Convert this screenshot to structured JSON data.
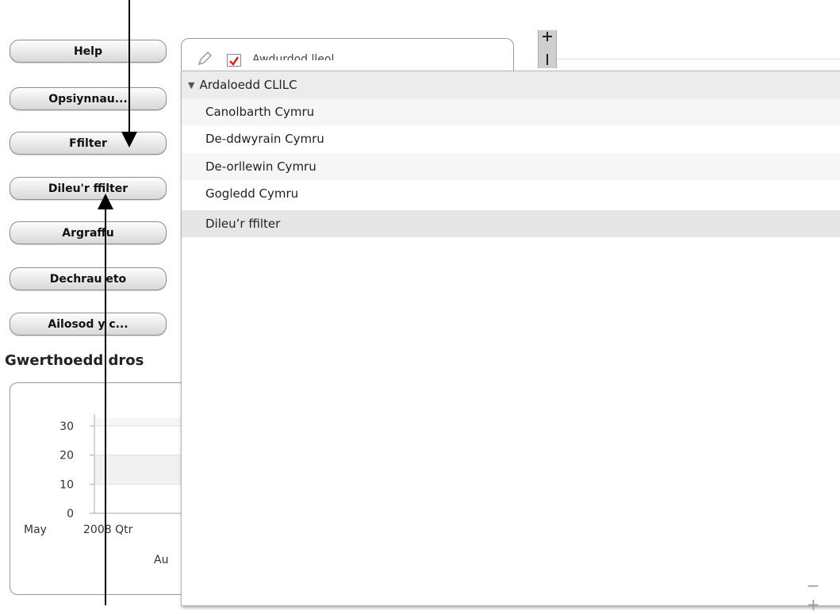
{
  "buttons": {
    "help": "Help",
    "options": "Opsiynnau...",
    "filter": "Ffilter",
    "clear_filter": "Dileu'r ffilter",
    "print": "Argraffu",
    "restart": "Dechrau eto",
    "reset": "Ailosod y c..."
  },
  "chart_title": "Gwerthoedd dros",
  "behind_panel_label": "Awdurdod lleol",
  "dropdown": {
    "header": "Ardaloedd CLlLC",
    "items": [
      "Canolbarth Cymru",
      "De-ddwyrain Cymru",
      "De-orllewin Cymru",
      "Gogledd Cymru"
    ],
    "clear": "Dileu’r ffilter"
  },
  "zoom_controls": "− +",
  "chart_data": {
    "type": "bar",
    "title": "Gwerthoedd dros",
    "yticks": [
      0,
      10,
      20,
      30
    ],
    "ylim": [
      0,
      30
    ],
    "x_tick_labels": [
      "May",
      "2008 Qtr",
      "Au"
    ]
  }
}
